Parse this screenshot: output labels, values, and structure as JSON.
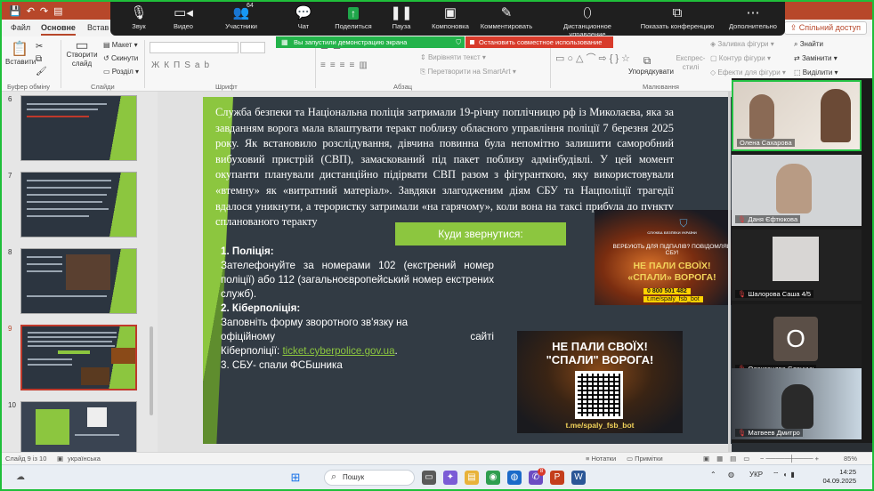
{
  "ppt": {
    "tabs": [
      {
        "label": "Файл"
      },
      {
        "label": "Основне"
      },
      {
        "label": "Встав"
      }
    ],
    "share_label": "Спільний доступ",
    "ribbon": {
      "paste": "Вставити",
      "new_slide": "Створити слайд",
      "layout": "Макет",
      "reset": "Скинути",
      "section": "Розділ",
      "clipboard": "Буфер обміну",
      "slides": "Слайди",
      "font": "Шрифт",
      "paragraph": "Абзац",
      "drawing": "Малювання",
      "text_direction": "Вирівняти текст",
      "smartart": "Перетворити на SmartArt",
      "arrange": "Упорядкувати",
      "quick_styles": "Експрес-стилі",
      "fill": "Заливка фігури",
      "outline": "Контур фігури",
      "effects": "Ефекти для фігури",
      "find": "Знайти",
      "replace": "Замінити",
      "select": "Виділити"
    },
    "thumbnails": [
      {
        "num": "6"
      },
      {
        "num": "7"
      },
      {
        "num": "8"
      },
      {
        "num": "9"
      },
      {
        "num": "10"
      }
    ],
    "status": {
      "slide_of": "Слайд 9 із 10",
      "language": "українська",
      "notes": "Нотатки",
      "comments": "Примітки",
      "zoom": "85%"
    }
  },
  "zoom_toolbar": {
    "items": [
      {
        "label": "Звук",
        "icon": "microphone-icon"
      },
      {
        "label": "Видео",
        "icon": "camera-icon"
      },
      {
        "label": "Участники",
        "icon": "participants-icon",
        "count": "64"
      },
      {
        "label": "Чат",
        "icon": "chat-icon"
      },
      {
        "label": "Поделиться",
        "icon": "share-screen-icon"
      },
      {
        "label": "Пауза",
        "icon": "pause-icon"
      },
      {
        "label": "Компоновка",
        "icon": "layout-icon"
      },
      {
        "label": "Комментировать",
        "icon": "annotate-icon"
      },
      {
        "label": "Дистанционное управление",
        "icon": "mouse-icon"
      },
      {
        "label": "Показать конференцию",
        "icon": "meeting-icon"
      },
      {
        "label": "Дополнительно",
        "icon": "more-icon"
      }
    ],
    "sharing_notice": "Вы запустили демонстрацию экрана",
    "stop_sharing": "Остановить совместное использование"
  },
  "slide": {
    "paragraph": "Служба безпеки та Національна поліція затримали 19-річну поплічницю рф із Миколаєва, яка за завданням ворога мала влаштувати теракт поблизу обласного управління поліції 7 березня 2025 року. Як встановило розслідування, дівчина повинна була непомітно залишити саморобний вибуховий пристрій (СВП), замаскований під пакет поблизу адмінбудівлі. У цей момент окупанти планували дистанційно підірвати СВП разом з фігуранткою, яку використовували «втемну» як «витратний матеріал». Завдяки злагодженим діям СБУ та Нацполіції трагедії вдалося уникнути, а терористку затримали «на гарячому», коли вона на таксі прибула до пункту спланованого теракту",
    "where_title": "Куди звернутися:",
    "item1_title": "1. Поліція:",
    "item1_text": "Зателефонуйте за номерами 102 (екстрений номер поліції) або 112 (загальноєвропейський номер екстрених служб).",
    "item2_title": "2. Кіберполіція:",
    "item2_text_a": "Заповніть форму зворотного зв'язку на",
    "item2_text_b": "офіційному",
    "item2_text_c": "сайті",
    "item2_text_d": "Кіберполіції:",
    "item2_link": "ticket.cyberpolice.gov.ua",
    "item2_end": ".",
    "item3": "3. СБУ- спали ФСБшника",
    "banner1": {
      "top": "СЛУЖБА БЕЗПЕКИ УКРАЇНИ",
      "q": "ВЕРБУЮТЬ ДЛЯ ПІДПАЛІВ? ПОВІДОМЛЯЙ СБУ!",
      "slogan1": "НЕ ПАЛИ СВОЇХ!",
      "slogan2": "«СПАЛИ» ВОРОГА!",
      "phone": "0 800 501 482",
      "tg": "t.me/spaly_fsb_bot"
    },
    "banner2": {
      "l1": "НЕ ПАЛИ СВОЇХ!",
      "l2": "\"СПАЛИ\" ВОРОГА!",
      "link": "t.me/spaly_fsb_bot"
    }
  },
  "participants": [
    {
      "name": "Олена Сахарова"
    },
    {
      "name": "Даня Єфтюкова"
    },
    {
      "name": "Шалорова Саша 4/5"
    },
    {
      "name": "Олександра Єленчук",
      "initial": "О"
    },
    {
      "name": "Матвеев Дмитро"
    }
  ],
  "taskbar": {
    "search": "Пошук",
    "lang": "УКР",
    "time": "14:25",
    "date": "04.09.2025",
    "badge": "8"
  },
  "colors": {
    "ppt_accent": "#b7472a",
    "slide_bg": "#323b44",
    "slide_green": "#8cc63f",
    "zoom_green": "#23b34a",
    "zoom_red": "#d83b2b"
  }
}
